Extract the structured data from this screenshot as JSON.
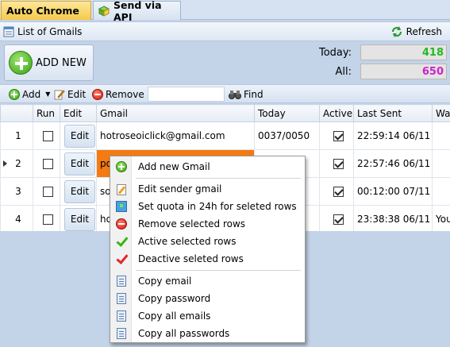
{
  "tabs": [
    {
      "label": "Auto Chrome"
    },
    {
      "label": "Send via API"
    }
  ],
  "panel": {
    "title": "List of Gmails",
    "refresh_label": "Refresh"
  },
  "add_new_label": "ADD NEW",
  "stats": {
    "today_label": "Today:",
    "today_value": "418",
    "today_color": "#22bb22",
    "all_label": "All:",
    "all_value": "650",
    "all_color": "#cc22cc"
  },
  "toolbar": {
    "add": "Add",
    "edit": "Edit",
    "remove": "Remove",
    "find": "Find"
  },
  "grid": {
    "columns": [
      "Run",
      "Edit",
      "Gmail",
      "Today",
      "Active",
      "Last Sent",
      "Wa"
    ],
    "edit_label": "Edit",
    "rows": [
      {
        "num": "1",
        "run": false,
        "gmail": "hotroseoiclick@gmail.com",
        "today": "0037/0050",
        "active": true,
        "last_sent": "22:59:14 06/11",
        "wa": ""
      },
      {
        "num": "2",
        "run": false,
        "gmail": "po",
        "today": "",
        "active": true,
        "last_sent": "22:57:46 06/11",
        "wa": ""
      },
      {
        "num": "3",
        "run": false,
        "gmail": "so",
        "today": "",
        "active": true,
        "last_sent": "00:12:00 07/11",
        "wa": ""
      },
      {
        "num": "4",
        "run": false,
        "gmail": "ho",
        "today": "",
        "active": true,
        "last_sent": "23:38:38 06/11",
        "wa": "You"
      }
    ]
  },
  "context_menu": {
    "add_new_gmail": "Add new Gmail",
    "edit_sender": "Edit sender gmail",
    "set_quota": "Set quota in 24h for seleted rows",
    "remove_selected": "Remove selected rows",
    "active_selected": "Active selected rows",
    "deactive_selected": "Deactive seleted rows",
    "copy_email": "Copy email",
    "copy_password": "Copy password",
    "copy_all_emails": "Copy all emails",
    "copy_all_passwords": "Copy all passwords"
  }
}
